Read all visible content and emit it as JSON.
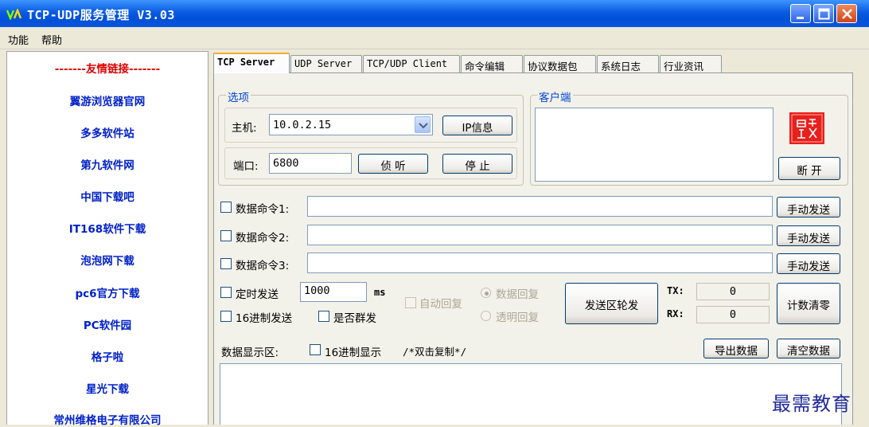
{
  "window": {
    "title": "TCP-UDP服务管理  V3.03"
  },
  "menu": {
    "items": [
      "功能",
      "帮助"
    ]
  },
  "sidebar": {
    "header": "-------友情链接-------",
    "links": [
      "翼游浏览器官网",
      "多多软件站",
      "第九软件网",
      "中国下载吧",
      "IT168软件下载",
      "泡泡网下载",
      "pc6官方下载",
      "PC软件园",
      "格子啦",
      "星光下载",
      "常州维格电子有限公司"
    ]
  },
  "tabs": [
    {
      "label": "TCP Server",
      "active": true
    },
    {
      "label": "UDP Server",
      "active": false
    },
    {
      "label": "TCP/UDP Client",
      "active": false
    },
    {
      "label": "命令编辑",
      "active": false
    },
    {
      "label": "协议数据包",
      "active": false
    },
    {
      "label": "系统日志",
      "active": false
    },
    {
      "label": "行业资讯",
      "active": false
    }
  ],
  "options": {
    "group_label": "选项",
    "host_label": "主机:",
    "host_value": "10.0.2.15",
    "ip_info_button": "IP信息",
    "port_label": "端口:",
    "port_value": "6800",
    "listen_button": "侦 听",
    "stop_button": "停 止"
  },
  "client": {
    "group_label": "客户端",
    "disconnect_button": "断 开",
    "logo_text": "旦缘 雪妙",
    "logo_color": "#E8201C"
  },
  "commands": [
    {
      "label": "数据命令1:",
      "value": "",
      "send_button": "手动发送"
    },
    {
      "label": "数据命令2:",
      "value": "",
      "send_button": "手动发送"
    },
    {
      "label": "数据命令3:",
      "value": "",
      "send_button": "手动发送"
    }
  ],
  "send_options": {
    "timed_send_label": "定时发送",
    "interval_value": "1000",
    "interval_unit": "ms",
    "hex_send_label": "16进制发送",
    "broadcast_label": "是否群发",
    "auto_reply_label": "自动回复",
    "data_reply_label": "数据回复",
    "transparent_reply_label": "透明回复",
    "rotate_button": "发送区轮发"
  },
  "counters": {
    "tx_label": "TX:",
    "tx_value": "0",
    "rx_label": "RX:",
    "rx_value": "0",
    "clear_button": "计数清零"
  },
  "display": {
    "label": "数据显示区:",
    "hex_display_label": "16进制显示",
    "hint": "/*双击复制*/",
    "export_button": "导出数据",
    "clear_button": "清空数据",
    "content": ""
  },
  "watermark": "最需教育",
  "colors": {
    "titlebar": "#0A5BE0",
    "link": "#0020C8",
    "link_header": "#E00000",
    "group_label": "#0046D5"
  }
}
